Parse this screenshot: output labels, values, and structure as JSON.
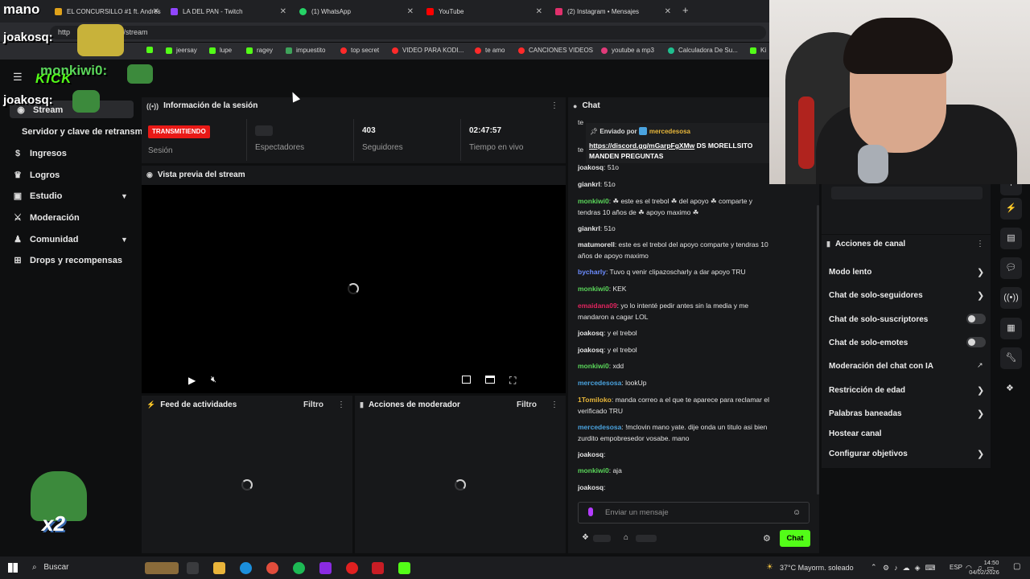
{
  "browser": {
    "tabs": [
      {
        "label": "EL CONCURSILLO #1 ft. Andrés",
        "color": "#e0a21a"
      },
      {
        "label": "LA DEL PAN - Twitch",
        "color": "#9146ff"
      },
      {
        "label": "(1) WhatsApp",
        "color": "#25d366"
      },
      {
        "label": "YouTube",
        "color": "#ff0000"
      },
      {
        "label": "(2) Instagram • Mensajes",
        "color": "#e1306c"
      }
    ],
    "new_tab": "+",
    "url_prefix": "http",
    "url": "ck.com/stream",
    "bookmarks": [
      {
        "label": "jeersay",
        "color": "#53fc18"
      },
      {
        "label": "lupe",
        "color": "#53fc18"
      },
      {
        "label": "ragey",
        "color": "#53fc18"
      },
      {
        "label": "impuestito",
        "color": "#3fa35a"
      },
      {
        "label": "top secret",
        "color": "#ff2a2a"
      },
      {
        "label": "VIDEO PARA KODI...",
        "color": "#ff2a2a"
      },
      {
        "label": "te amo",
        "color": "#ff2a2a"
      },
      {
        "label": "CANCIONES VIDEOS",
        "color": "#ff2a2a"
      },
      {
        "label": "youtube a mp3",
        "color": "#e23b7a"
      },
      {
        "label": "Calculadora De Su...",
        "color": "#1fbf8f"
      },
      {
        "label": "Ki",
        "color": "#53fc18"
      }
    ]
  },
  "overlay": {
    "brand": "mano",
    "user1": "joakosq:",
    "user2": "monkiwi0:",
    "kick": "KICK",
    "user3": "joakosq:",
    "multiplier": "x2"
  },
  "sidebar": {
    "items": [
      {
        "label": "Stream"
      },
      {
        "label": "Servidor y clave de retransm"
      },
      {
        "label": "Ingresos"
      },
      {
        "label": "Logros"
      },
      {
        "label": "Estudio"
      },
      {
        "label": "Moderación"
      },
      {
        "label": "Comunidad"
      },
      {
        "label": "Drops y recompensas"
      }
    ]
  },
  "session": {
    "title": "Información de la sesión",
    "live_badge": "TRANSMITIENDO",
    "session_label": "Sesión",
    "viewers_label": "Espectadores",
    "followers_value": "403",
    "followers_label": "Seguidores",
    "live_time_value": "02:47:57",
    "live_time_label": "Tiempo en vivo"
  },
  "preview": {
    "title": "Vista previa del stream"
  },
  "feed": {
    "title": "Feed de actividades",
    "filter": "Filtro"
  },
  "modactions": {
    "title": "Acciones de moderador",
    "filter": "Filtro"
  },
  "chat": {
    "title": "Chat",
    "pinned_by": "Enviado por",
    "pinned_user": "mercedesosa",
    "pinned_link": "https://discord.gg/mGarpFgXMw",
    "pinned_text": "DS MORELLSITO",
    "pinned_text2": "MANDEN PREGUNTAS",
    "messages": [
      {
        "user": "joakosq",
        "text": ": 51o",
        "color": "#e6e6e6"
      },
      {
        "user": "giankrl",
        "text": ": 51o",
        "color": "#e6e6e6"
      },
      {
        "user": "monkiwi0",
        "text": ": ☘ este es el trebol ☘ del apoyo ☘ comparte y",
        "color": "#5ad65a"
      },
      {
        "user": "",
        "text": "tendras 10 años de ☘ apoyo maximo ☘",
        "color": "#e6e6e6"
      },
      {
        "user": "giankrl",
        "text": ": 51o",
        "color": "#e6e6e6"
      },
      {
        "user": "matumorell",
        "text": ": este es el trebol del apoyo comparte y tendras 10",
        "color": "#e6e6e6"
      },
      {
        "user": "",
        "text": "años de apoyo maximo",
        "color": "#e6e6e6"
      },
      {
        "user": "bycharly",
        "text": ": Tuvo q venir clipazoscharly a dar apoyo TRU",
        "color": "#6c8cff"
      },
      {
        "user": "monkiwi0",
        "text": ": KEK",
        "color": "#5ad65a"
      },
      {
        "user": "emaidana09",
        "text": ": yo lo intenté pedir antes sin la media y me",
        "color": "#e0245e"
      },
      {
        "user": "",
        "text": "mandaron a cagar LOL",
        "color": "#e6e6e6"
      },
      {
        "user": "joakosq",
        "text": ": y el trebol",
        "color": "#e6e6e6"
      },
      {
        "user": "joakosq",
        "text": ": y el trebol",
        "color": "#e6e6e6"
      },
      {
        "user": "monkiwi0",
        "text": ": xdd",
        "color": "#5ad65a"
      },
      {
        "user": "mercedesosa",
        "text": ": lookUp",
        "color": "#4aa3df"
      },
      {
        "user": "1Tomiloko",
        "text": ": manda correo a el que te aparece para reclamar el",
        "color": "#e8b73a"
      },
      {
        "user": "",
        "text": "verificado TRU",
        "color": "#e6e6e6"
      },
      {
        "user": "mercedesosa",
        "text": ": !mclovin mano yate. dije onda un titulo asi bien",
        "color": "#4aa3df"
      },
      {
        "user": "",
        "text": "zurdito empobresedor vosabe. mano",
        "color": "#e6e6e6"
      },
      {
        "user": "joakosq",
        "text": ":",
        "color": "#e6e6e6"
      },
      {
        "user": "monkiwi0",
        "text": ": aja",
        "color": "#5ad65a"
      },
      {
        "user": "joakosq",
        "text": ":",
        "color": "#e6e6e6"
      }
    ],
    "input_placeholder": "Enviar un mensaje",
    "send_button": "Chat"
  },
  "channel_actions": {
    "title": "Acciones de canal",
    "items": [
      {
        "label": "Modo lento"
      },
      {
        "label": "Chat de solo-seguidores"
      },
      {
        "label": "Chat de solo-suscriptores"
      },
      {
        "label": "Chat de solo-emotes"
      },
      {
        "label": "Moderación del chat con IA"
      },
      {
        "label": "Restricción de edad"
      },
      {
        "label": "Palabras baneadas"
      },
      {
        "label": "Hostear canal"
      },
      {
        "label": "Configurar objetivos"
      }
    ]
  },
  "taskbar": {
    "search": "Buscar",
    "weather": "37°C  Mayorm. soleado",
    "lang": "ESP",
    "time": "14:50",
    "date": "04/02/2026"
  },
  "colors": {
    "accent": "#53fc18",
    "live": "#e91916"
  }
}
